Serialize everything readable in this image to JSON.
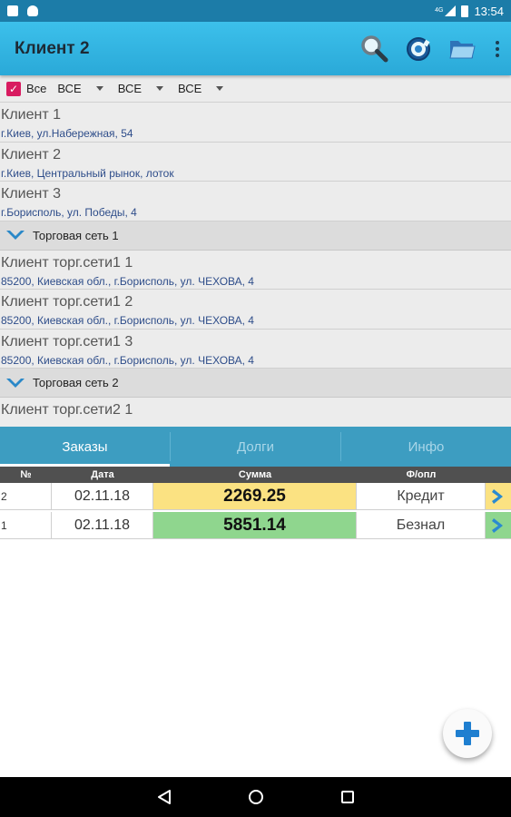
{
  "status_bar": {
    "time": "13:54",
    "network": "4G"
  },
  "app_bar": {
    "title": "Клиент 2",
    "icons": [
      "search-icon",
      "settings-icon",
      "folder-icon",
      "overflow-menu-icon"
    ]
  },
  "filters": {
    "all_label": "Все",
    "all_checked": true,
    "dropdown_1": "ВСЕ",
    "dropdown_2": "ВСЕ",
    "dropdown_3": "ВСЕ"
  },
  "clients": [
    {
      "name": "Клиент 1",
      "address": "г.Киев, ул.Набережная, 54"
    },
    {
      "name": "Клиент 2",
      "address": "г.Киев, Центральный рынок, лоток"
    },
    {
      "name": "Клиент 3",
      "address": "г.Борисполь, ул. Победы, 4"
    }
  ],
  "group_1": {
    "title": "Торговая сеть 1",
    "clients": [
      {
        "name": "Клиент торг.сети1 1",
        "address": "85200, Киевская обл., г.Борисполь, ул. ЧЕХОВА, 4"
      },
      {
        "name": "Клиент торг.сети1 2",
        "address": "85200, Киевская обл., г.Борисполь, ул. ЧЕХОВА, 4"
      },
      {
        "name": "Клиент торг.сети1 3",
        "address": "85200, Киевская обл., г.Борисполь, ул. ЧЕХОВА, 4"
      }
    ]
  },
  "group_2": {
    "title": "Торговая сеть 2",
    "clients": [
      {
        "name": "Клиент торг.сети2 1"
      }
    ]
  },
  "tabs": [
    {
      "label": "Заказы",
      "active": true
    },
    {
      "label": "Долги",
      "active": false
    },
    {
      "label": "Инфо",
      "active": false
    }
  ],
  "orders_table": {
    "headers": {
      "num": "№",
      "date": "Дата",
      "sum": "Сумма",
      "payment": "Ф/опл"
    },
    "rows": [
      {
        "num": "2",
        "date": "02.11.18",
        "sum": "2269.25",
        "payment": "Кредит",
        "color": "#fbe282"
      },
      {
        "num": "1",
        "date": "02.11.18",
        "sum": "5851.14",
        "payment": "Безнал",
        "color": "#8fd68e"
      }
    ]
  },
  "colors": {
    "app_bar": "#35b8e6",
    "tabs": "#3d9dc1",
    "checkbox": "#d81b60",
    "credit_row": "#fbe282",
    "cashless_row": "#8fd68e"
  },
  "fab": {
    "icon": "plus-icon"
  }
}
